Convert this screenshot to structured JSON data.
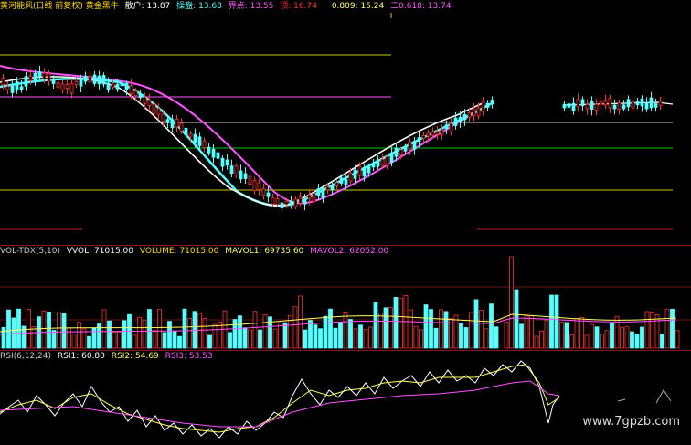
{
  "colors": {
    "bg": "#000000",
    "up": "#ff3232",
    "down": "#55ffff",
    "white_ma": "#ffffff",
    "cyan_ma": "#55ffff",
    "magenta_ma": "#ff55ff",
    "yellow_line": "#c8c800",
    "green_line": "#00c800",
    "pink_line": "#ff55ff",
    "rsi1": "#ffffff",
    "rsi2": "#ffff66",
    "rsi3": "#ff55ff",
    "vol_ma1": "#ffff66",
    "vol_ma2": "#ff55ff"
  },
  "price_header": {
    "indicator": "黄河能风(日线 前复权) 黄金黑牛",
    "sell_label": "散户: 13.87",
    "ops_label": "操盘: 13.68",
    "boundary_label": "界点: 13.55",
    "push_label": "顶: 16.74",
    "line1_label": "一0.809: 15.24",
    "line2_label": "二0.618: 13.74"
  },
  "vol_header": {
    "name": "VOL-TDX(5,10)",
    "vvol": "VVOL: 71015.00",
    "volume": "VOLUME: 71015.00",
    "mavol1": "MAVOL1: 69735.60",
    "mavol2": "MAVOL2: 62052.00"
  },
  "rsi_header": {
    "name": "RSI(6,12,24)",
    "rsi1": "RSI1: 60.80",
    "rsi2": "RSI2: 54.69",
    "rsi3": "RSI3: 53.53"
  },
  "watermark": "www.7gpzb.com"
}
